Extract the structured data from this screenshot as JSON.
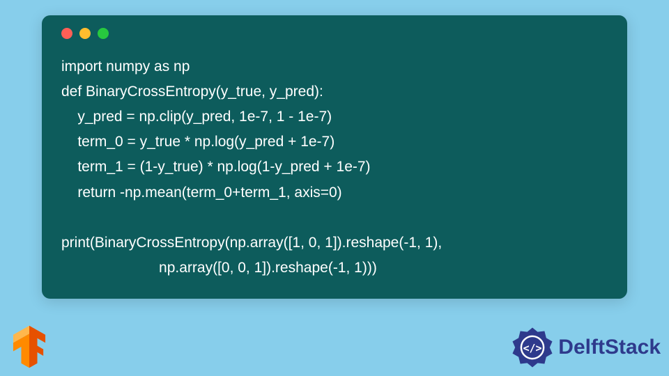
{
  "code": {
    "lines": [
      "import numpy as np",
      "def BinaryCrossEntropy(y_true, y_pred):",
      "    y_pred = np.clip(y_pred, 1e-7, 1 - 1e-7)",
      "    term_0 = y_true * np.log(y_pred + 1e-7)",
      "    term_1 = (1-y_true) * np.log(1-y_pred + 1e-7)",
      "    return -np.mean(term_0+term_1, axis=0)",
      "",
      "print(BinaryCrossEntropy(np.array([1, 0, 1]).reshape(-1, 1),",
      "                        np.array([0, 0, 1]).reshape(-1, 1)))"
    ]
  },
  "window": {
    "dot_colors": {
      "red": "#ff5f56",
      "yellow": "#ffbd2e",
      "green": "#27c93f"
    },
    "bg": "#0d5c5c"
  },
  "branding": {
    "delft_label": "DelftStack",
    "delft_color": "#2e3a8c",
    "tf_orange": "#ff8a00",
    "tf_dark": "#e65100"
  },
  "page_bg": "#87ceeb"
}
